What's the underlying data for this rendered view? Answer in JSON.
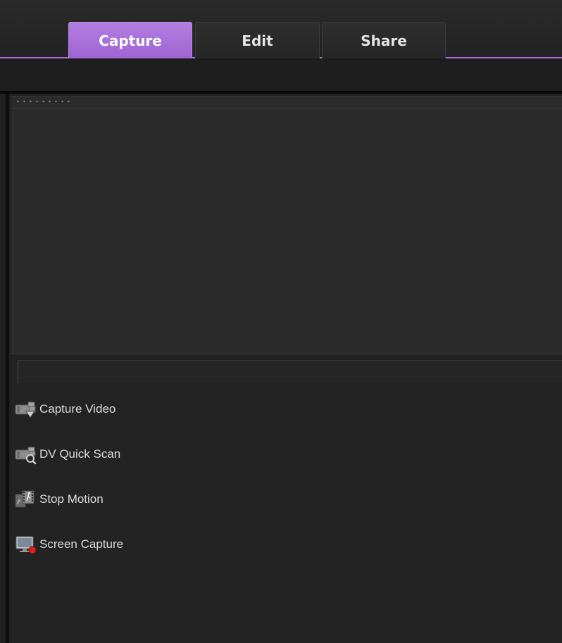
{
  "tabs": [
    {
      "label": "Capture",
      "active": true
    },
    {
      "label": "Edit",
      "active": false
    },
    {
      "label": "Share",
      "active": false
    }
  ],
  "capture_options": [
    {
      "label": "Capture Video",
      "icon": "camcorder-icon"
    },
    {
      "label": "DV Quick Scan",
      "icon": "camcorder-scan-icon"
    },
    {
      "label": "Stop Motion",
      "icon": "film-stop-motion-icon"
    },
    {
      "label": "Screen Capture",
      "icon": "monitor-record-icon"
    }
  ],
  "colors": {
    "accent": "#a86bd6",
    "active_tab": "#b27ee0",
    "background": "#1c1c1c",
    "panel": "#2b2b2b",
    "text": "#dcdcdc",
    "record": "#e02020"
  }
}
